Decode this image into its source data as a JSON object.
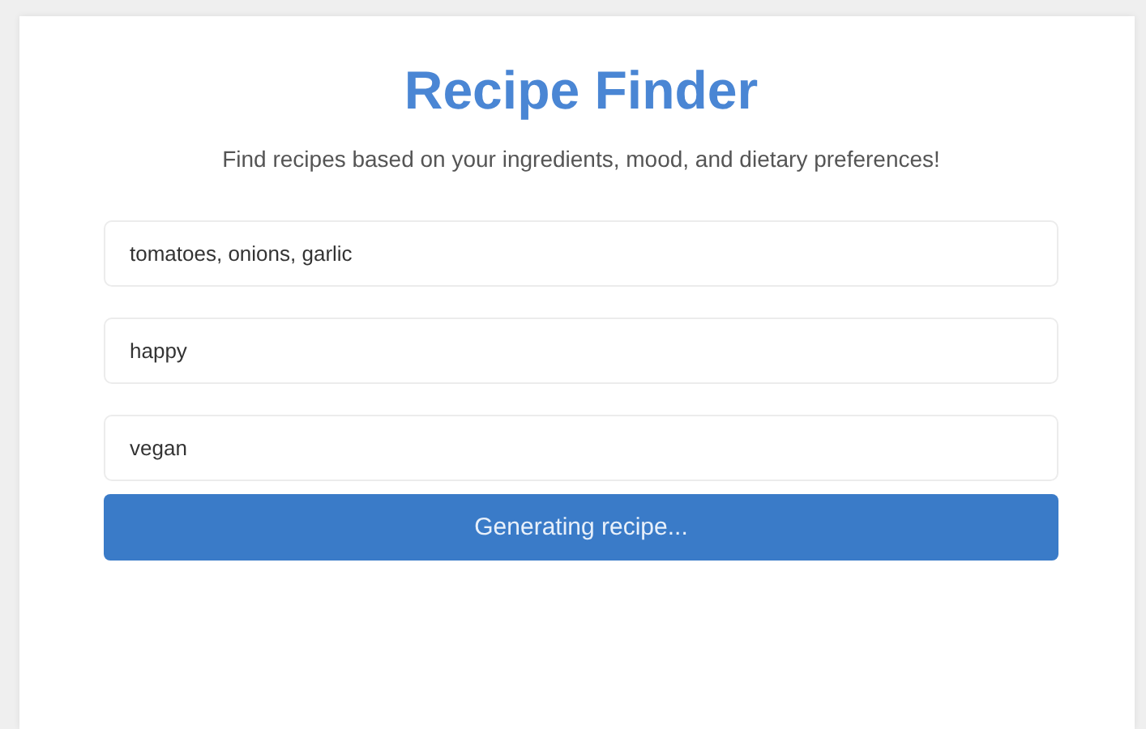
{
  "title": "Recipe Finder",
  "subtitle": "Find recipes based on your ingredients, mood, and dietary preferences!",
  "fields": [
    {
      "value": "tomatoes, onions, garlic"
    },
    {
      "value": "happy"
    },
    {
      "value": "vegan"
    }
  ],
  "submit_button": {
    "label": "Generating recipe...",
    "disabled": true
  }
}
